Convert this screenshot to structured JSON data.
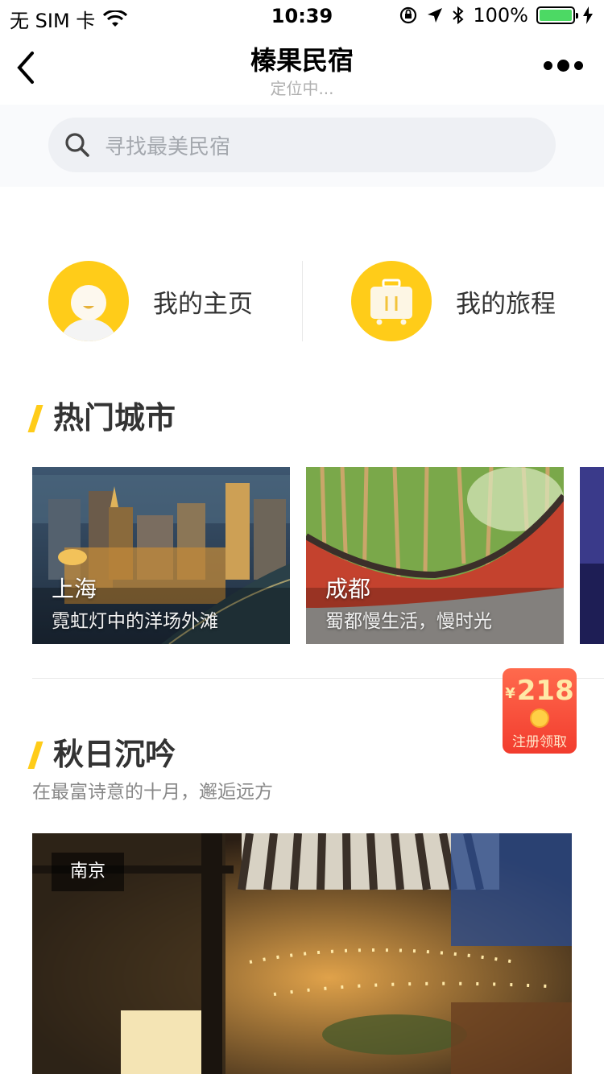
{
  "status_bar": {
    "carrier": "无 SIM 卡",
    "time": "10:39",
    "battery": "100%",
    "battery_level": 1.0
  },
  "nav": {
    "title": "榛果民宿",
    "subtitle": "定位中..."
  },
  "search": {
    "placeholder": "寻找最美民宿"
  },
  "quick": {
    "home_label": "我的主页",
    "trip_label": "我的旅程"
  },
  "hot_cities": {
    "title": "热门城市",
    "cards": [
      {
        "name": "上海",
        "desc": "霓虹灯中的洋场外滩"
      },
      {
        "name": "成都",
        "desc": "蜀都慢生活，慢时光"
      }
    ]
  },
  "red_packet": {
    "currency": "¥",
    "amount": "218",
    "label": "注册领取"
  },
  "autumn": {
    "title": "秋日沉吟",
    "subtitle": "在最富诗意的十月，邂逅远方",
    "feature_tag": "南京"
  },
  "colors": {
    "accent_yellow": "#ffcc19",
    "red_packet": "#f23c2e"
  }
}
